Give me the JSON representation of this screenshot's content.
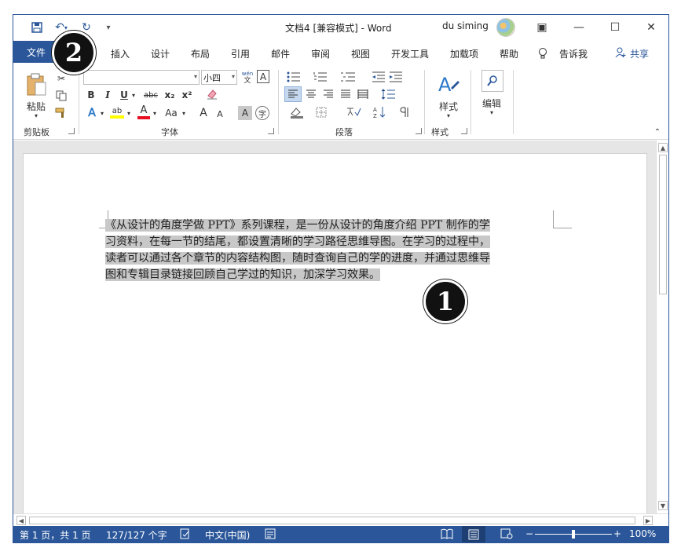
{
  "window": {
    "title": "文档4 [兼容模式]  -  Word",
    "user": "du siming",
    "buttons": {
      "ribbon_display": "▣",
      "minimize": "—",
      "maximize": "☐",
      "close": "✕"
    }
  },
  "quick_access": {
    "save": "save-icon",
    "undo": "undo-icon",
    "redo": "redo-icon",
    "customize": "customize-icon"
  },
  "menu": {
    "file": "文件",
    "tabs": [
      "插入",
      "设计",
      "布局",
      "引用",
      "邮件",
      "审阅",
      "视图",
      "开发工具",
      "加载项",
      "帮助"
    ],
    "tell_me": "告诉我",
    "share": "共享"
  },
  "ribbon": {
    "clipboard": {
      "paste": "粘贴",
      "label": "剪贴板"
    },
    "font": {
      "name": "",
      "size": "小四",
      "label": "字体",
      "wen": "wén 文",
      "A_box": "A",
      "bold": "B",
      "italic": "I",
      "underline": "U",
      "strike": "abc",
      "subscript": "x₂",
      "superscript": "x²",
      "effects": "A",
      "highlight": "ab",
      "color": "A",
      "case": "Aa",
      "grow": "A",
      "shrink": "A",
      "shade": "A",
      "enclose": "字"
    },
    "paragraph": {
      "label": "段落"
    },
    "styles": {
      "button": "样式",
      "label": "样式"
    },
    "editing": {
      "button": "编辑"
    }
  },
  "document": {
    "lines": [
      "《从设计的角度学做 PPT》系列课程，是一份从设计的角度介绍 PPT 制作的学",
      "习资料，在每一节的结尾，都设置清晰的学习路径思维导图。在学习的过程中，",
      "读者可以通过各个章节的内容结构图，随时查询自己的学的进度，并通过思维导",
      "图和专辑目录链接回顾自己学过的知识，加深学习效果。"
    ]
  },
  "status": {
    "page": "第 1 页，共 1 页",
    "words": "127/127 个字",
    "language": "中文(中国)",
    "zoom": "100%",
    "zoom_fraction": 0.5
  },
  "callouts": {
    "one": "1",
    "two": "2"
  },
  "colors": {
    "accent": "#2b579a",
    "selection": "#c8c8c8",
    "highlight_yellow": "#ffff00",
    "font_red": "#e81123"
  }
}
